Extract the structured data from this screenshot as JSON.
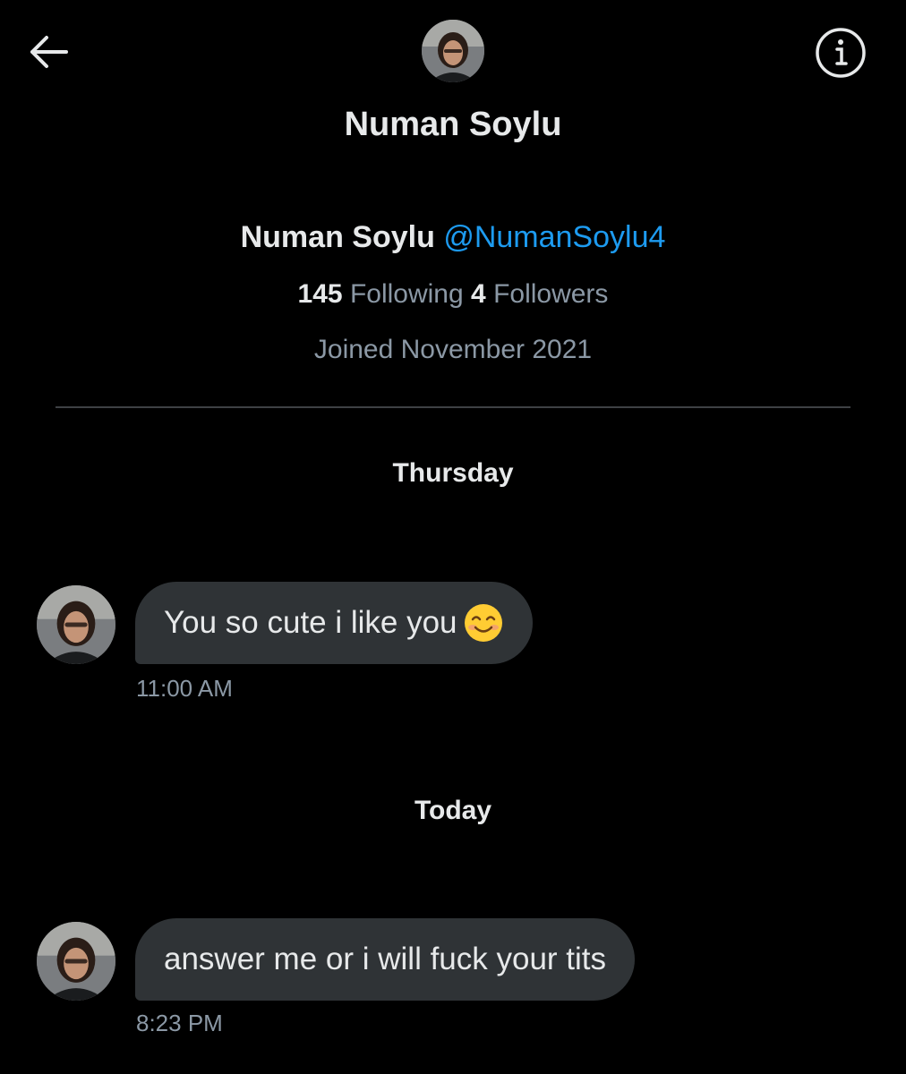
{
  "header": {
    "contact_name": "Numan Soylu",
    "back_icon": "back-arrow-icon",
    "info_icon": "info-icon"
  },
  "profile": {
    "name": "Numan Soylu",
    "handle": "@NumanSoylu4",
    "following_count": "145",
    "following_label": "Following",
    "followers_count": "4",
    "followers_label": "Followers",
    "joined": "Joined November 2021"
  },
  "colors": {
    "background": "#000000",
    "bubble": "#2f3336",
    "handle": "#1d9bf0",
    "secondary_text": "#8b98a5"
  },
  "conversation": {
    "groups": [
      {
        "day": "Thursday",
        "messages": [
          {
            "text": "You so cute i like you",
            "emoji": "smiling-face-icon",
            "time": "11:00 AM"
          }
        ]
      },
      {
        "day": "Today",
        "messages": [
          {
            "text": "answer me or i will fuck your tits",
            "time": "8:23 PM"
          }
        ]
      }
    ]
  }
}
